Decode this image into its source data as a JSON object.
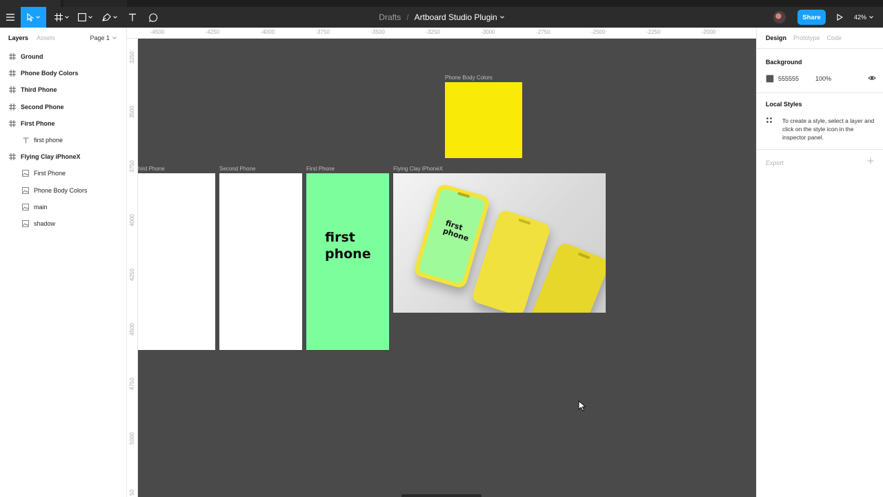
{
  "toolbar": {
    "breadcrumb_folder": "Drafts",
    "breadcrumb_separator": "/",
    "file_name": "Artboard Studio Plugin",
    "share_label": "Share",
    "zoom_level": "42%"
  },
  "left_panel": {
    "tabs": {
      "layers": "Layers",
      "assets": "Assets"
    },
    "page_selector": "Page 1",
    "layers": [
      {
        "label": "Ground",
        "type": "frame"
      },
      {
        "label": "Phone Body Colors",
        "type": "frame"
      },
      {
        "label": "Third Phone",
        "type": "frame"
      },
      {
        "label": "Second Phone",
        "type": "frame"
      },
      {
        "label": "First Phone",
        "type": "frame"
      },
      {
        "label": "first phone",
        "type": "text"
      },
      {
        "label": "Flying Clay iPhoneX",
        "type": "frame"
      },
      {
        "label": "First Phone",
        "type": "image"
      },
      {
        "label": "Phone Body Colors",
        "type": "image"
      },
      {
        "label": "main",
        "type": "image"
      },
      {
        "label": "shadow",
        "type": "image"
      }
    ]
  },
  "rulers": {
    "horizontal": [
      "-4500",
      "-4250",
      "-4000",
      "-3750",
      "-3500",
      "-3250",
      "-3000",
      "-2750",
      "-2500",
      "-2250",
      "-2000"
    ],
    "vertical": [
      "3250",
      "3500",
      "3750",
      "4000",
      "4250",
      "4500",
      "4750",
      "5000",
      "50"
    ]
  },
  "canvas": {
    "background": "#4a4a4a",
    "artboards": {
      "phone_body_colors": {
        "label": "Phone Body Colors",
        "color": "#f9ea07"
      },
      "third_phone": {
        "label": "Third Phone",
        "visible_label": "hird Phone",
        "color": "#ffffff"
      },
      "second_phone": {
        "label": "Second Phone",
        "color": "#ffffff"
      },
      "first_phone": {
        "label": "First Phone",
        "color": "#7dfe9c",
        "text_line1": "first",
        "text_line2": "phone"
      },
      "flying_clay": {
        "label": "Flying Clay iPhoneX",
        "screen_text_line1": "first",
        "screen_text_line2": "phone"
      }
    }
  },
  "right_panel": {
    "tabs": {
      "design": "Design",
      "prototype": "Prototype",
      "code": "Code"
    },
    "background_title": "Background",
    "background_hex": "555555",
    "background_opacity": "100%",
    "background_color": "#555555",
    "local_styles_title": "Local Styles",
    "local_styles_help": "To create a style, select a layer and click on the style icon in the inspector panel.",
    "export_label": "Export"
  },
  "colors": {
    "accent": "#18a0fb",
    "toolbar_bg": "#2c2c2c"
  }
}
